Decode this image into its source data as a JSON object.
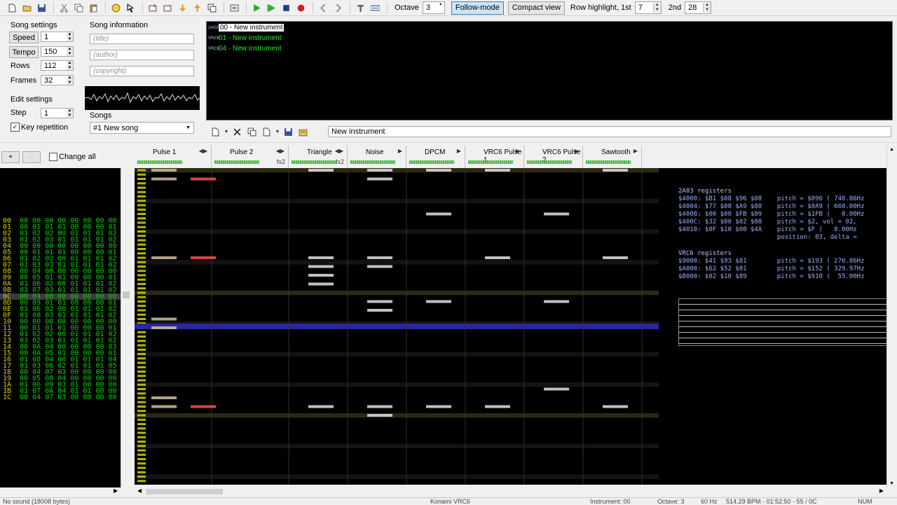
{
  "toolbar": {
    "octave_label": "Octave",
    "octave_value": "3",
    "follow_mode": "Follow-mode",
    "compact_view": "Compact view",
    "row_highlight_label": "Row highlight, 1st",
    "row_highlight_1st": "7",
    "second_label": "2nd",
    "row_highlight_2nd": "28"
  },
  "song_settings": {
    "title": "Song settings",
    "speed_label": "Speed",
    "speed": "1",
    "tempo_label": "Tempo",
    "tempo": "150",
    "rows_label": "Rows",
    "rows": "112",
    "frames_label": "Frames",
    "frames": "32"
  },
  "edit_settings": {
    "title": "Edit settings",
    "step_label": "Step",
    "step": "1",
    "key_repetition": "Key repetition"
  },
  "song_info": {
    "title": "Song information",
    "title_ph": "(title)",
    "author_ph": "(author)",
    "copyright_ph": "(copyright)"
  },
  "songs": {
    "label": "Songs",
    "selected": "#1 New song"
  },
  "instruments": [
    {
      "badge": "2A03",
      "name": "00 - New instrument",
      "selected": true
    },
    {
      "badge": "VRC6",
      "name": "01 - New instrument",
      "selected": false
    },
    {
      "badge": "VRC6",
      "name": "04 - New instrument",
      "selected": false
    }
  ],
  "instrument_name": "New instrument",
  "frame_controls": {
    "add": "+",
    "remove": "-",
    "change_all": "Change all"
  },
  "channels": [
    {
      "name": "Pulse 1",
      "fx": ""
    },
    {
      "name": "Pulse 2",
      "fx": "fx2"
    },
    {
      "name": "Triangle",
      "fx": "fx2"
    },
    {
      "name": "Noise",
      "fx": ""
    },
    {
      "name": "DPCM",
      "fx": ""
    },
    {
      "name": "VRC6 Pulse 1",
      "fx": ""
    },
    {
      "name": "VRC6 Pulse 2",
      "fx": ""
    },
    {
      "name": "Sawtooth",
      "fx": ""
    }
  ],
  "frames": [
    {
      "i": "00",
      "d": "00 00 00 00 00 00 00 00"
    },
    {
      "i": "01",
      "d": "00 01 01 01 00 00 00 01"
    },
    {
      "i": "02",
      "d": "01 02 02 00 01 01 01 02"
    },
    {
      "i": "03",
      "d": "01 02 03 01 01 01 01 02"
    },
    {
      "i": "04",
      "d": "00 00 00 00 00 00 00 00"
    },
    {
      "i": "05",
      "d": "00 01 01 01 00 00 00 01"
    },
    {
      "i": "06",
      "d": "01 02 02 00 01 01 01 02"
    },
    {
      "i": "07",
      "d": "01 03 03 01 01 01 01 02"
    },
    {
      "i": "08",
      "d": "00 04 00 00 00 00 00 00"
    },
    {
      "i": "09",
      "d": "00 05 01 01 00 00 00 01"
    },
    {
      "i": "0A",
      "d": "01 06 02 00 01 01 01 02"
    },
    {
      "i": "0B",
      "d": "01 07 03 01 01 01 01 02"
    },
    {
      "i": "0C",
      "d": "00 04 00 00 00 00 00 00"
    },
    {
      "i": "0D",
      "d": "00 09 01 01 00 00 00 01"
    },
    {
      "i": "0E",
      "d": "01 06 02 00 01 01 01 02"
    },
    {
      "i": "0F",
      "d": "01 08 03 01 01 01 01 02"
    },
    {
      "i": "10",
      "d": "00 00 00 00 00 00 00 00"
    },
    {
      "i": "11",
      "d": "00 01 01 01 00 00 00 01"
    },
    {
      "i": "12",
      "d": "01 02 02 00 01 01 01 02"
    },
    {
      "i": "13",
      "d": "01 02 03 01 01 01 01 02"
    },
    {
      "i": "14",
      "d": "00 0A 04 00 00 00 00 03"
    },
    {
      "i": "15",
      "d": "00 0A 05 01 00 00 00 01"
    },
    {
      "i": "16",
      "d": "01 08 04 00 01 01 01 04"
    },
    {
      "i": "17",
      "d": "01 03 06 02 01 01 01 05"
    },
    {
      "i": "18",
      "d": "00 04 07 03 00 00 00 00"
    },
    {
      "i": "19",
      "d": "00 05 08 04 00 00 00 00"
    },
    {
      "i": "1A",
      "d": "01 06 09 03 01 00 00 00"
    },
    {
      "i": "1B",
      "d": "01 07 0A 04 01 01 00 00"
    },
    {
      "i": "1C",
      "d": "00 04 07 03 00 00 00 00"
    }
  ],
  "registers": {
    "h2a03": "2A03 registers",
    "r2a03": [
      "$4000: $B1 $08 $96 $08    pitch = $096 ( 740.86Hz",
      "$4004: $77 $08 $A9 $08    pitch = $0A9 ( 660.00Hz",
      "$4008: $00 $00 $FB $09    pitch = $1FB (   0.00Hz",
      "$400C: $32 $00 $02 $08    pitch = $2, vol = 02,",
      "$4010: $0F $10 $00 $4A    pitch = $F (   0.00Hz",
      "                          position: 03, delta ="
    ],
    "hvrc6": "VRC6 registers",
    "rvrc6": [
      "$9000: $41 $93 $81        pitch = $193 ( 276.86Hz",
      "$A000: $62 $52 $81        pitch = $152 ( 329.97Hz",
      "$B000: $02 $10 $89        pitch = $910 (  55.00Hz"
    ]
  },
  "status": {
    "left": "No sound (18008 bytes)",
    "chip": "Konami VRC6",
    "instrument": "Instrument: 00",
    "octave": "Octave: 3",
    "rate": "60 Hz",
    "tempo": "514.29 BPM - 01:52:50 - 55 / 0C",
    "num": "NUM"
  }
}
